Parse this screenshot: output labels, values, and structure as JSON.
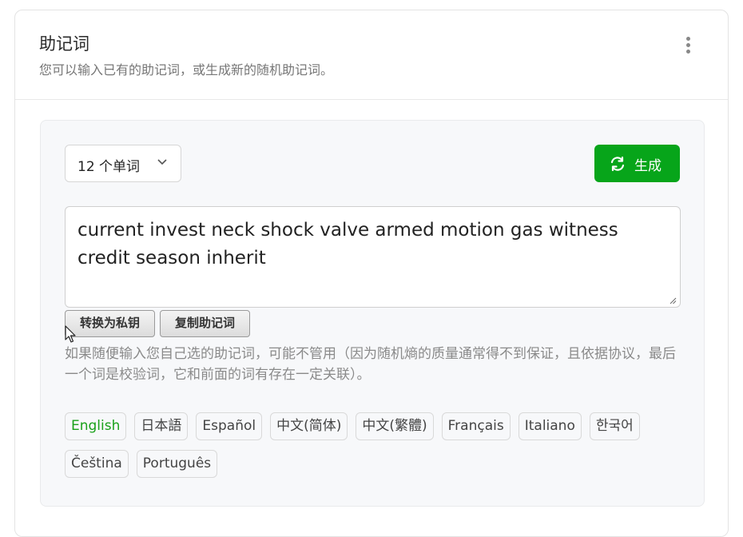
{
  "header": {
    "title": "助记词",
    "subtitle": "您可以输入已有的助记词，或生成新的随机助记词。",
    "menu_icon": "kebab-menu-icon"
  },
  "controls": {
    "word_count_selected": "12 个单词",
    "generate_label": "生成",
    "generate_icon": "refresh-icon",
    "accent_color": "#07a51a"
  },
  "mnemonic": {
    "value": "current invest neck shock valve armed motion gas witness credit season inherit"
  },
  "actions": {
    "convert_label": "转换为私钥",
    "copy_label": "复制助记词"
  },
  "hint": "如果随便输入您自己选的助记词，可能不管用（因为随机熵的质量通常得不到保证，且依据协议，最后一个词是校验词，它和前面的词有存在一定关联）。",
  "languages": {
    "items": [
      "English",
      "日本語",
      "Español",
      "中文(简体)",
      "中文(繁體)",
      "Français",
      "Italiano",
      "한국어",
      "Čeština",
      "Português"
    ],
    "selected": "English"
  }
}
